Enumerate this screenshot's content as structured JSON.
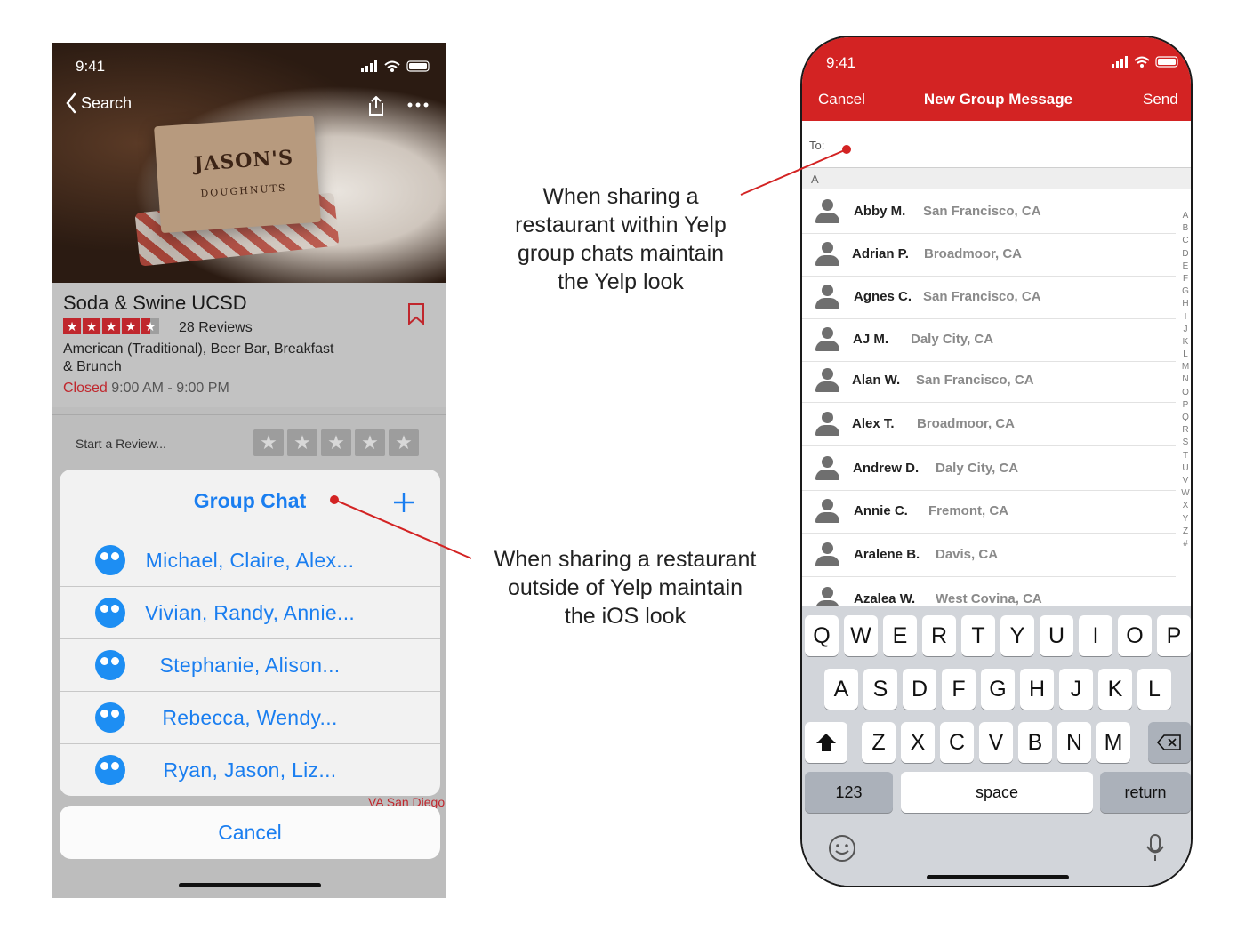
{
  "left_phone": {
    "status_time": "9:41",
    "back_label": "Search",
    "hero_brand": "JASON'S",
    "hero_sub": "DOUGHNUTS",
    "business_name": "Soda & Swine UCSD",
    "rating_stars": 4.5,
    "reviews": "28 Reviews",
    "categories_line1": "American (Traditional), Beer Bar, Breakfast",
    "categories_line2": "& Brunch",
    "status_closed": "Closed",
    "hours": "9:00 AM - 9:00 PM",
    "start_review": "Start a Review...",
    "sheet_title": "Group Chat",
    "chats": [
      "Michael, Claire, Alex...",
      "Vivian, Randy, Annie...",
      "Stephanie, Alison...",
      "Rebecca, Wendy...",
      "Ryan, Jason, Liz..."
    ],
    "map_label": "VA San Diego",
    "cancel": "Cancel"
  },
  "right_phone": {
    "status_time": "9:41",
    "cancel": "Cancel",
    "title": "New Group Message",
    "send": "Send",
    "to_label": "To:",
    "section_letter": "A",
    "contacts": [
      {
        "name": "Abby M.",
        "city": "San Francisco, CA"
      },
      {
        "name": "Adrian P.",
        "city": "Broadmoor, CA"
      },
      {
        "name": "Agnes C.",
        "city": "San Francisco, CA"
      },
      {
        "name": "AJ M.",
        "city": "Daly City, CA"
      },
      {
        "name": "Alan W.",
        "city": "San Francisco, CA"
      },
      {
        "name": "Alex T.",
        "city": "Broadmoor, CA"
      },
      {
        "name": "Andrew D.",
        "city": "Daly City, CA"
      },
      {
        "name": "Annie C.",
        "city": "Fremont, CA"
      },
      {
        "name": "Aralene B.",
        "city": "Davis, CA"
      },
      {
        "name": "Azalea W.",
        "city": "West Covina, CA"
      }
    ],
    "index_letters": [
      "A",
      "B",
      "C",
      "D",
      "E",
      "F",
      "G",
      "H",
      "I",
      "J",
      "K",
      "L",
      "M",
      "N",
      "O",
      "P",
      "Q",
      "R",
      "S",
      "T",
      "U",
      "V",
      "W",
      "X",
      "Y",
      "Z",
      "#"
    ],
    "keyboard": {
      "row1": [
        "Q",
        "W",
        "E",
        "R",
        "T",
        "Y",
        "U",
        "I",
        "O",
        "P"
      ],
      "row2": [
        "A",
        "S",
        "D",
        "F",
        "G",
        "H",
        "J",
        "K",
        "L"
      ],
      "row3": [
        "Z",
        "X",
        "C",
        "V",
        "B",
        "N",
        "M"
      ],
      "numbers": "123",
      "space": "space",
      "return": "return"
    }
  },
  "annotations": {
    "yelp_note": [
      "When sharing a",
      "restaurant within Yelp",
      "group chats maintain",
      "the Yelp look"
    ],
    "ios_note": [
      "When sharing a restaurant",
      "outside of Yelp maintain",
      "the iOS look"
    ]
  },
  "colors": {
    "yelp_red": "#d32323",
    "ios_blue": "#1a7ef0"
  }
}
